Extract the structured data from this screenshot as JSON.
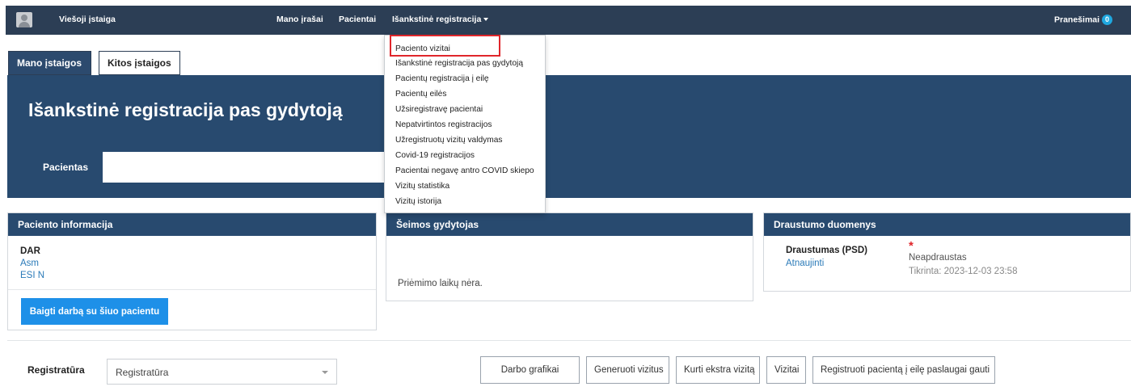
{
  "navbar": {
    "org": "Viešoji įstaiga",
    "links": [
      "Mano įrašai",
      "Pacientai",
      "Išankstinė registracija"
    ],
    "notifications_label": "Pranešimai",
    "notifications_count": "0"
  },
  "tabs": [
    "Mano įstaigos",
    "Kitos įstaigos"
  ],
  "page_title": "Išankstinė registracija pas gydytoją",
  "patient_field_label": "Pacientas",
  "dropdown_items": [
    "Paciento vizitai",
    "Išankstinė registracija pas gydytoją",
    "Pacientų registracija į eilę",
    "Pacientų eilės",
    "Užsiregistravę pacientai",
    "Nepatvirtintos registracijos",
    "Užregistruotų vizitų valdymas",
    "Covid-19 registracijos",
    "Pacientai negavę antro COVID skiepo",
    "Vizitų statistika",
    "Vizitų istorija"
  ],
  "patient_info": {
    "title": "Paciento informacija",
    "name": "DAR",
    "line2": "Asm",
    "line3": "ESI N",
    "finish_button": "Baigti darbą su šiuo pacientu"
  },
  "family_doctor": {
    "title": "Šeimos gydytojas",
    "empty_text": "Priėmimo laikų nėra."
  },
  "insurance": {
    "title": "Draustumo duomenys",
    "label": "Draustumas (PSD)",
    "refresh_link": "Atnaujinti",
    "asterisk": "*",
    "status": "Neapdraustas",
    "checked": "Tikrinta: 2023-12-03 23:58"
  },
  "bottom": {
    "registry_label": "Registratūra",
    "registry_value": "Registratūra",
    "buttons": [
      "Darbo grafikai",
      "Generuoti vizitus",
      "Kurti ekstra vizitą",
      "Vizitai",
      "Registruoti pacientą į eilę paslaugai gauti"
    ]
  },
  "colors": {
    "navbar": "#2c3e55",
    "header_blue": "#284a6f",
    "primary_button": "#1e90e8",
    "highlight_red": "#e0262b",
    "link_blue": "#2a7ab8"
  }
}
